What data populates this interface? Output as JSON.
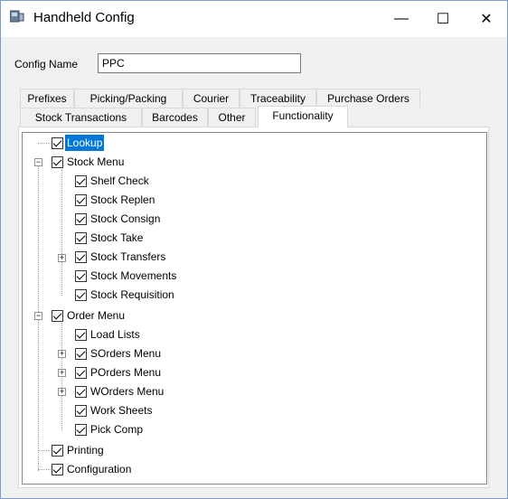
{
  "window": {
    "title": "Handheld Config",
    "minimize": "—",
    "maximize": "☐",
    "close": "✕"
  },
  "config": {
    "label": "Config Name",
    "value": "PPC"
  },
  "tabs_row1": [
    "Prefixes",
    "Picking/Packing",
    "Courier",
    "Traceability",
    "Purchase Orders"
  ],
  "tabs_row2": [
    "Stock Transactions",
    "Barcodes",
    "Other",
    "Functionality"
  ],
  "active_tab": "Functionality",
  "tree": [
    {
      "label": "Lookup",
      "selected": true
    },
    {
      "label": "Stock Menu"
    },
    {
      "label": "Shelf Check"
    },
    {
      "label": "Stock Replen"
    },
    {
      "label": "Stock Consign"
    },
    {
      "label": "Stock Take"
    },
    {
      "label": "Stock Transfers"
    },
    {
      "label": "Stock Movements"
    },
    {
      "label": "Stock Requisition"
    },
    {
      "label": "Order Menu"
    },
    {
      "label": "Load Lists"
    },
    {
      "label": "SOrders Menu"
    },
    {
      "label": "POrders Menu"
    },
    {
      "label": "WOrders Menu"
    },
    {
      "label": "Work Sheets"
    },
    {
      "label": "Pick Comp"
    },
    {
      "label": "Printing"
    },
    {
      "label": "Configuration"
    }
  ],
  "colors": {
    "selection": "#0078d7",
    "window_bg": "#f0f0f0"
  }
}
